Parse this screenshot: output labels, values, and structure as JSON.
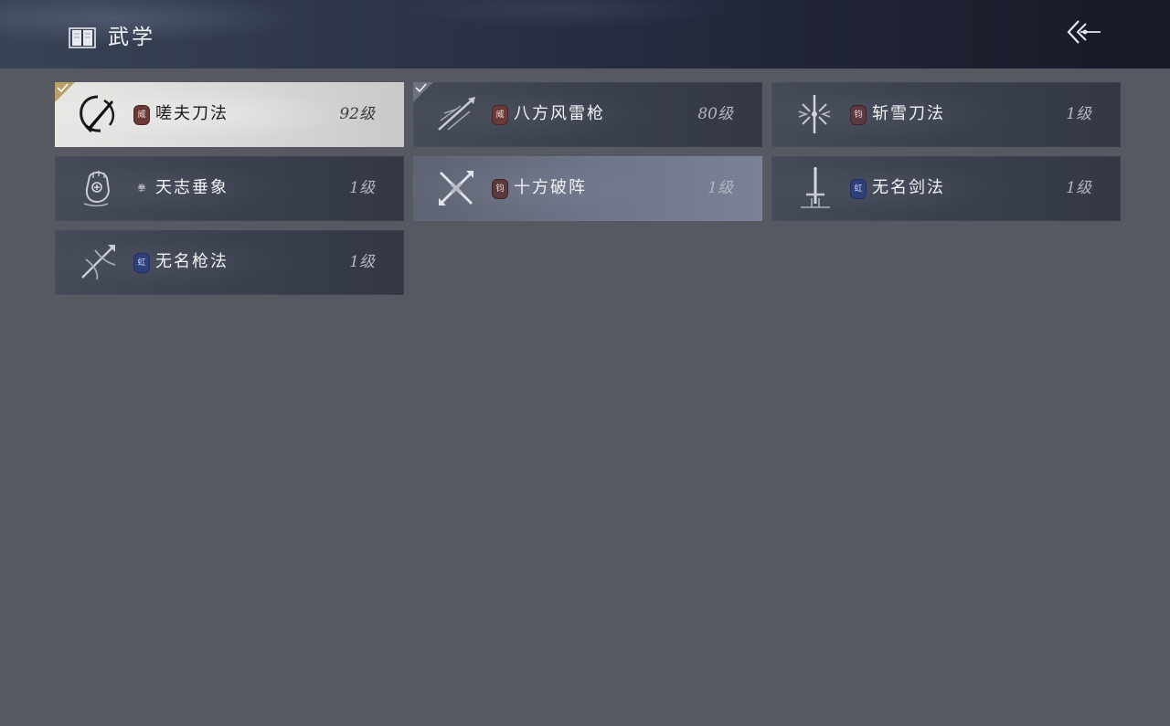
{
  "header": {
    "title": "武学",
    "book_icon": "book-icon",
    "back_icon": "back-arrow-icon"
  },
  "colors": {
    "background": "#565862",
    "selected_corner": "#b8a068",
    "equipped_corner": "#6d7284",
    "badge_wei": "#6b3a37",
    "badge_hong": "#2f3f7a"
  },
  "skills": [
    {
      "name": "嗟夫刀法",
      "level": "92级",
      "badge": "威",
      "icon": "blade-swirl-icon",
      "selected": true,
      "marked": true
    },
    {
      "name": "八方风雷枪",
      "level": "80级",
      "badge": "威",
      "icon": "spear-strike-icon",
      "selected": false,
      "marked": true
    },
    {
      "name": "斩雪刀法",
      "level": "1级",
      "badge": "钧",
      "icon": "snow-blade-icon",
      "selected": false,
      "marked": false
    },
    {
      "name": "天志垂象",
      "level": "1级",
      "badge": "拳",
      "icon": "fist-sigil-icon",
      "selected": false,
      "marked": false
    },
    {
      "name": "十方破阵",
      "level": "1级",
      "badge": "钧",
      "icon": "crossed-blades-icon",
      "selected": false,
      "marked": false
    },
    {
      "name": "无名剑法",
      "level": "1级",
      "badge": "虹",
      "icon": "sword-icon",
      "selected": false,
      "marked": false
    },
    {
      "name": "无名枪法",
      "level": "1级",
      "badge": "虹",
      "icon": "spear-slash-icon",
      "selected": false,
      "marked": false
    }
  ]
}
